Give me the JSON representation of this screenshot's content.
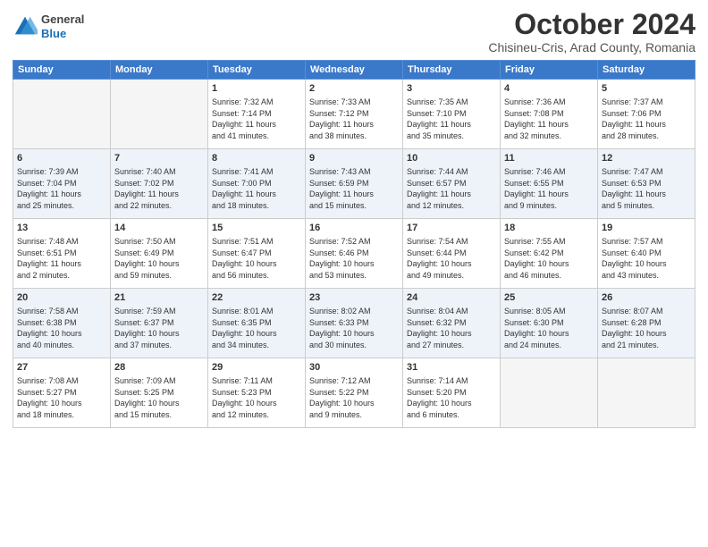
{
  "header": {
    "logo": {
      "general": "General",
      "blue": "Blue"
    },
    "title": "October 2024",
    "location": "Chisineu-Cris, Arad County, Romania"
  },
  "weekdays": [
    "Sunday",
    "Monday",
    "Tuesday",
    "Wednesday",
    "Thursday",
    "Friday",
    "Saturday"
  ],
  "weeks": [
    [
      {
        "day": "",
        "info": ""
      },
      {
        "day": "",
        "info": ""
      },
      {
        "day": "1",
        "info": "Sunrise: 7:32 AM\nSunset: 7:14 PM\nDaylight: 11 hours\nand 41 minutes."
      },
      {
        "day": "2",
        "info": "Sunrise: 7:33 AM\nSunset: 7:12 PM\nDaylight: 11 hours\nand 38 minutes."
      },
      {
        "day": "3",
        "info": "Sunrise: 7:35 AM\nSunset: 7:10 PM\nDaylight: 11 hours\nand 35 minutes."
      },
      {
        "day": "4",
        "info": "Sunrise: 7:36 AM\nSunset: 7:08 PM\nDaylight: 11 hours\nand 32 minutes."
      },
      {
        "day": "5",
        "info": "Sunrise: 7:37 AM\nSunset: 7:06 PM\nDaylight: 11 hours\nand 28 minutes."
      }
    ],
    [
      {
        "day": "6",
        "info": "Sunrise: 7:39 AM\nSunset: 7:04 PM\nDaylight: 11 hours\nand 25 minutes."
      },
      {
        "day": "7",
        "info": "Sunrise: 7:40 AM\nSunset: 7:02 PM\nDaylight: 11 hours\nand 22 minutes."
      },
      {
        "day": "8",
        "info": "Sunrise: 7:41 AM\nSunset: 7:00 PM\nDaylight: 11 hours\nand 18 minutes."
      },
      {
        "day": "9",
        "info": "Sunrise: 7:43 AM\nSunset: 6:59 PM\nDaylight: 11 hours\nand 15 minutes."
      },
      {
        "day": "10",
        "info": "Sunrise: 7:44 AM\nSunset: 6:57 PM\nDaylight: 11 hours\nand 12 minutes."
      },
      {
        "day": "11",
        "info": "Sunrise: 7:46 AM\nSunset: 6:55 PM\nDaylight: 11 hours\nand 9 minutes."
      },
      {
        "day": "12",
        "info": "Sunrise: 7:47 AM\nSunset: 6:53 PM\nDaylight: 11 hours\nand 5 minutes."
      }
    ],
    [
      {
        "day": "13",
        "info": "Sunrise: 7:48 AM\nSunset: 6:51 PM\nDaylight: 11 hours\nand 2 minutes."
      },
      {
        "day": "14",
        "info": "Sunrise: 7:50 AM\nSunset: 6:49 PM\nDaylight: 10 hours\nand 59 minutes."
      },
      {
        "day": "15",
        "info": "Sunrise: 7:51 AM\nSunset: 6:47 PM\nDaylight: 10 hours\nand 56 minutes."
      },
      {
        "day": "16",
        "info": "Sunrise: 7:52 AM\nSunset: 6:46 PM\nDaylight: 10 hours\nand 53 minutes."
      },
      {
        "day": "17",
        "info": "Sunrise: 7:54 AM\nSunset: 6:44 PM\nDaylight: 10 hours\nand 49 minutes."
      },
      {
        "day": "18",
        "info": "Sunrise: 7:55 AM\nSunset: 6:42 PM\nDaylight: 10 hours\nand 46 minutes."
      },
      {
        "day": "19",
        "info": "Sunrise: 7:57 AM\nSunset: 6:40 PM\nDaylight: 10 hours\nand 43 minutes."
      }
    ],
    [
      {
        "day": "20",
        "info": "Sunrise: 7:58 AM\nSunset: 6:38 PM\nDaylight: 10 hours\nand 40 minutes."
      },
      {
        "day": "21",
        "info": "Sunrise: 7:59 AM\nSunset: 6:37 PM\nDaylight: 10 hours\nand 37 minutes."
      },
      {
        "day": "22",
        "info": "Sunrise: 8:01 AM\nSunset: 6:35 PM\nDaylight: 10 hours\nand 34 minutes."
      },
      {
        "day": "23",
        "info": "Sunrise: 8:02 AM\nSunset: 6:33 PM\nDaylight: 10 hours\nand 30 minutes."
      },
      {
        "day": "24",
        "info": "Sunrise: 8:04 AM\nSunset: 6:32 PM\nDaylight: 10 hours\nand 27 minutes."
      },
      {
        "day": "25",
        "info": "Sunrise: 8:05 AM\nSunset: 6:30 PM\nDaylight: 10 hours\nand 24 minutes."
      },
      {
        "day": "26",
        "info": "Sunrise: 8:07 AM\nSunset: 6:28 PM\nDaylight: 10 hours\nand 21 minutes."
      }
    ],
    [
      {
        "day": "27",
        "info": "Sunrise: 7:08 AM\nSunset: 5:27 PM\nDaylight: 10 hours\nand 18 minutes."
      },
      {
        "day": "28",
        "info": "Sunrise: 7:09 AM\nSunset: 5:25 PM\nDaylight: 10 hours\nand 15 minutes."
      },
      {
        "day": "29",
        "info": "Sunrise: 7:11 AM\nSunset: 5:23 PM\nDaylight: 10 hours\nand 12 minutes."
      },
      {
        "day": "30",
        "info": "Sunrise: 7:12 AM\nSunset: 5:22 PM\nDaylight: 10 hours\nand 9 minutes."
      },
      {
        "day": "31",
        "info": "Sunrise: 7:14 AM\nSunset: 5:20 PM\nDaylight: 10 hours\nand 6 minutes."
      },
      {
        "day": "",
        "info": ""
      },
      {
        "day": "",
        "info": ""
      }
    ]
  ]
}
